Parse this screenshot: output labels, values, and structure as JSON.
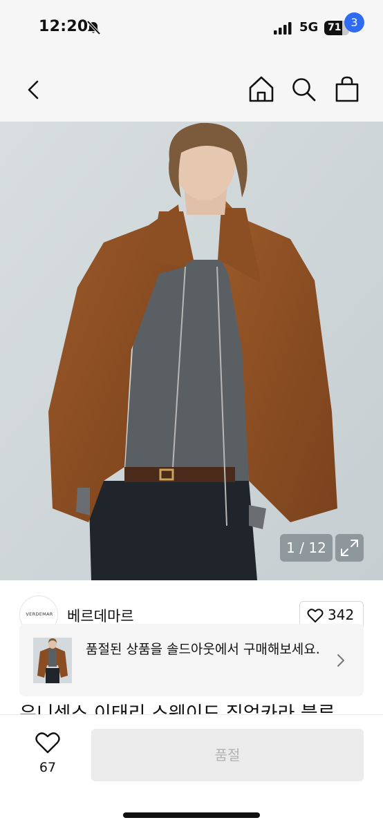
{
  "status_bar": {
    "time": "12:20",
    "network": "5G",
    "battery_level": "71",
    "battery_fraction": 0.71,
    "icons": [
      "bell-slash-icon",
      "signal-bars-icon",
      "battery-icon"
    ]
  },
  "nav": {
    "icons": [
      "chevron-left-icon",
      "home-icon",
      "search-icon",
      "shopping-bag-icon"
    ],
    "cart_badge": "3",
    "badge_color": "#2f6bf0"
  },
  "gallery": {
    "counter": "1 / 12",
    "current": 1,
    "total": 12,
    "icons": [
      "expand-icon"
    ]
  },
  "seller": {
    "logo_text": "VERDEMAR",
    "name": "베르데마르"
  },
  "like": {
    "count": "342",
    "icon": "heart-outline-icon"
  },
  "soldout_banner": {
    "text": "품절된 상품을 솔드아웃에서 구매해보세요.",
    "icon": "chevron-right-icon"
  },
  "product": {
    "title_partial": "유니섹스 이태리 스웨이드 집업카라 블루"
  },
  "bottom_bar": {
    "wish_count": "67",
    "action_label": "품절",
    "icon": "heart-outline-icon"
  }
}
